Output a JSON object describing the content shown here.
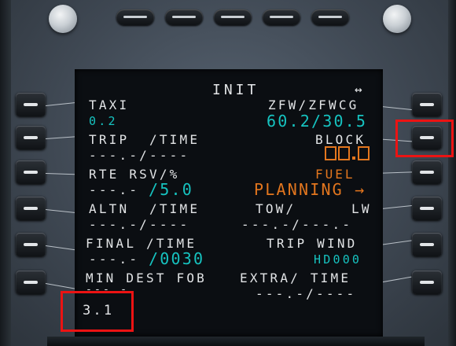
{
  "page": {
    "title": "INIT",
    "arrows": "↔"
  },
  "left": {
    "taxi_label": "TAXI",
    "taxi_value": "0.2",
    "trip_label": "TRIP  /TIME",
    "trip_value": "---.-/----",
    "rte_rsv_label": "RTE RSV/%",
    "rte_rsv_value": "---.-",
    "rte_rsv_pct": "/5.0",
    "altn_label": "ALTN  /TIME",
    "altn_value": "---.-/----",
    "final_label": "FINAL /TIME",
    "final_value": "---.-",
    "final_time": "/0030",
    "min_dest_label": "MIN DEST FOB",
    "min_dest_dashes": "---.-",
    "min_dest_value": "3.1"
  },
  "right": {
    "zfw_label": "ZFW/ZFWCG",
    "zfw_value": "60.2/30.5",
    "block_label": "BLOCK",
    "fuel_label": "FUEL",
    "planning_label": "PLANNING →",
    "tow_label": "TOW/",
    "lw_label": "LW",
    "tow_lw_value": "---.-/---.-",
    "trip_wind_label": "TRIP WIND",
    "trip_wind_value": "HD000",
    "extra_label": "EXTRA/ TIME",
    "extra_value": "---.-/----"
  },
  "colors": {
    "white": "#e2e4e6",
    "green": "#16c3c0",
    "amber": "#e3761e",
    "highlight": "#ec1313"
  }
}
